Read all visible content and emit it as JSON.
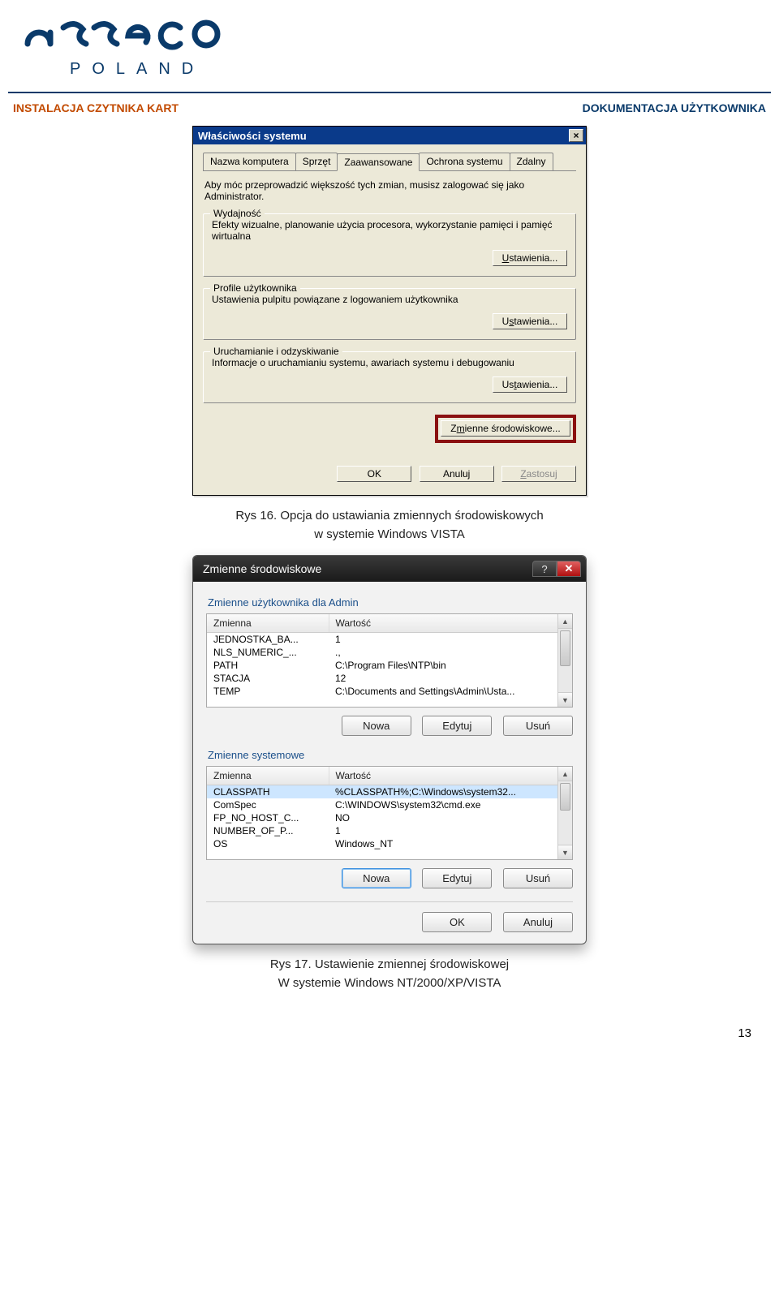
{
  "brand": {
    "sub": "POLAND"
  },
  "header": {
    "left": "INSTALACJA CZYTNIKA KART",
    "right": "DOKUMENTACJA  UŻYTKOWNIKA"
  },
  "classic": {
    "title": "Właściwości systemu",
    "intro": "Aby móc przeprowadzić większość tych zmian, musisz zalogować się jako Administrator.",
    "tabs": [
      "Nazwa komputera",
      "Sprzęt",
      "Zaawansowane",
      "Ochrona systemu",
      "Zdalny"
    ],
    "active_tab_index": 2,
    "groups": {
      "perf": {
        "legend": "Wydajność",
        "desc": "Efekty wizualne, planowanie użycia procesora, wykorzystanie pamięci i pamięć wirtualna",
        "btn": "Ustawienia..."
      },
      "prof": {
        "legend": "Profile użytkownika",
        "desc": "Ustawienia pulpitu powiązane z logowaniem użytkownika",
        "btn": "Ustawienia..."
      },
      "boot": {
        "legend": "Uruchamianie i odzyskiwanie",
        "desc": "Informacje o uruchamianiu systemu, awariach systemu i debugowaniu",
        "btn": "Ustawienia..."
      }
    },
    "env_btn": "Zmienne środowiskowe...",
    "footer": {
      "ok": "OK",
      "cancel": "Anuluj",
      "apply": "Zastosuj"
    }
  },
  "caption1a": "Rys 16. Opcja do ustawiania zmiennych środowiskowych",
  "caption1b": "w systemie Windows VISTA",
  "aero": {
    "title": "Zmienne środowiskowe",
    "user_group": "Zmienne użytkownika dla Admin",
    "sys_group": "Zmienne systemowe",
    "col_name": "Zmienna",
    "col_value": "Wartość",
    "user_rows": [
      {
        "n": "JEDNOSTKA_BA...",
        "v": "1"
      },
      {
        "n": "NLS_NUMERIC_...",
        "v": ".,"
      },
      {
        "n": "PATH",
        "v": "C:\\Program Files\\NTP\\bin"
      },
      {
        "n": "STACJA",
        "v": "12"
      },
      {
        "n": "TEMP",
        "v": "C:\\Documents and Settings\\Admin\\Usta..."
      }
    ],
    "sys_rows": [
      {
        "n": "CLASSPATH",
        "v": "%CLASSPATH%;C:\\Windows\\system32..."
      },
      {
        "n": "ComSpec",
        "v": "C:\\WINDOWS\\system32\\cmd.exe"
      },
      {
        "n": "FP_NO_HOST_C...",
        "v": "NO"
      },
      {
        "n": "NUMBER_OF_P...",
        "v": "1"
      },
      {
        "n": "OS",
        "v": "Windows_NT"
      }
    ],
    "btns": {
      "new": "Nowa",
      "edit": "Edytuj",
      "del": "Usuń",
      "ok": "OK",
      "cancel": "Anuluj"
    }
  },
  "caption2a": "Rys 17. Ustawienie zmiennej środowiskowej",
  "caption2b": "W systemie Windows NT/2000/XP/VISTA",
  "pagenum": "13"
}
